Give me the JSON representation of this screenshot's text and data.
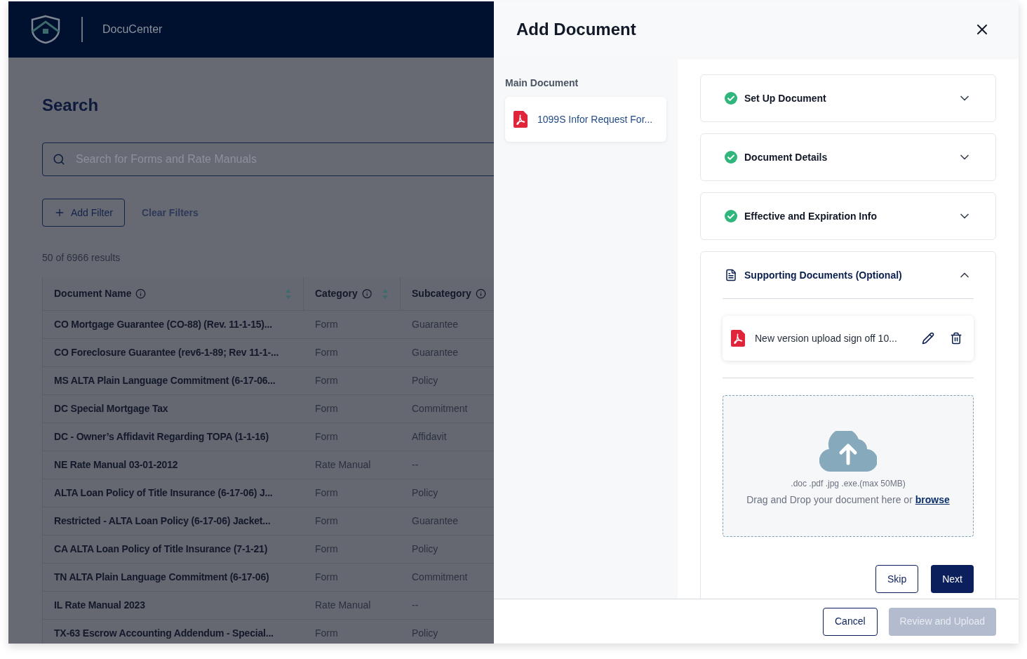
{
  "app": {
    "name": "DocuCenter"
  },
  "search_page": {
    "title": "Search",
    "search": {
      "placeholder": "Search for Forms and Rate Manuals"
    },
    "add_filter": "Add Filter",
    "clear_filters": "Clear Filters",
    "results": "50 of 6966 results",
    "table": {
      "columns": [
        {
          "label": "Document Name",
          "sortable": true
        },
        {
          "label": "Category",
          "sortable": true
        },
        {
          "label": "Subcategory",
          "sortable": false
        }
      ],
      "rows": [
        [
          "CO Mortgage Guarantee (CO-88) (Rev. 11-1-15)...",
          "Form",
          "Guarantee"
        ],
        [
          "CO Foreclosure Guarantee (rev6-1-89; Rev 11-1-...",
          "Form",
          "Guarantee"
        ],
        [
          "MS ALTA Plain Language Commitment (6-17-06...",
          "Form",
          "Policy"
        ],
        [
          "DC Special Mortgage Tax",
          "Form",
          "Commitment"
        ],
        [
          "DC - Owner’s Affidavit Regarding TOPA (1-1-16)",
          "Form",
          "Affidavit"
        ],
        [
          "NE Rate Manual 03-01-2012",
          "Rate Manual",
          "--"
        ],
        [
          "ALTA Loan Policy of Title Insurance (6-17-06) J...",
          "Form",
          "Policy"
        ],
        [
          "Restricted - ALTA Loan Policy (6-17-06) Jacket...",
          "Form",
          "Guarantee"
        ],
        [
          "CA ALTA Loan Policy of Title Insurance (7-1-21)",
          "Form",
          "Policy"
        ],
        [
          "TN ALTA Plain Language Commitment (6-17-06)",
          "Form",
          "Commitment"
        ],
        [
          "IL Rate Manual 2023",
          "Rate Manual",
          "--"
        ],
        [
          "TX-63 Escrow Accounting Addendum - Special...",
          "Form",
          "Policy"
        ]
      ]
    }
  },
  "dialog": {
    "title": "Add Document",
    "main_document": {
      "label": "Main Document",
      "file": "1099S Infor Request For..."
    },
    "steps": [
      {
        "title": "Set Up Document",
        "kind": "done",
        "expanded": false
      },
      {
        "title": "Document Details",
        "kind": "done",
        "expanded": false
      },
      {
        "title": "Effective and Expiration Info",
        "kind": "done",
        "expanded": false
      },
      {
        "title": "Supporting Documents (Optional)",
        "kind": "current",
        "expanded": true
      }
    ],
    "supporting_files": [
      {
        "name": "New version upload sign off 10..."
      }
    ],
    "dropzone": {
      "formats": ".doc .pdf .jpg .exe.(max 50MB)",
      "text": "Drag and Drop your document here or",
      "link": "browse"
    },
    "step_buttons": [
      {
        "label": "Skip",
        "kind": "secondary"
      },
      {
        "label": "Next",
        "kind": "primary"
      }
    ],
    "footer_buttons": [
      {
        "label": "Cancel",
        "kind": "secondary",
        "disabled": false
      },
      {
        "label": "Review and Upload",
        "kind": "primary",
        "disabled": true
      }
    ]
  }
}
